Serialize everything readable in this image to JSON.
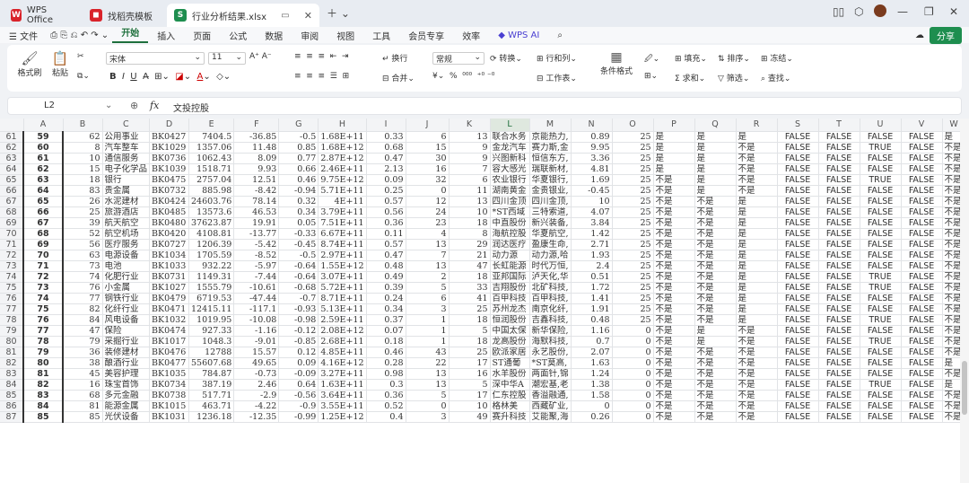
{
  "tabs": [
    {
      "label": "WPS Office"
    },
    {
      "label": "找稻壳模板"
    },
    {
      "label": "行业分析结果.xlsx"
    }
  ],
  "menubar": {
    "file": "文件",
    "items": [
      "开始",
      "插入",
      "页面",
      "公式",
      "数据",
      "审阅",
      "视图",
      "工具",
      "会员专享",
      "效率"
    ],
    "wps_ai": "WPS AI",
    "share": "分享"
  },
  "ribbon": {
    "format_painter": "格式刷",
    "paste": "粘贴",
    "font": "宋体",
    "font_size": "11",
    "wrap": "换行",
    "merge": "合并",
    "number_format": "常规",
    "convert": "转换",
    "rowcol": "行和列",
    "worksheet": "工作表",
    "cond_format": "条件格式",
    "fill": "填充",
    "sort": "排序",
    "freeze": "冻结",
    "sum": "求和",
    "filter": "筛选",
    "find": "查找"
  },
  "formula": {
    "cell_ref": "L2",
    "fx": "fx",
    "value": "文投控股"
  },
  "columns": [
    "A",
    "B",
    "C",
    "D",
    "E",
    "F",
    "G",
    "H",
    "I",
    "J",
    "K",
    "L",
    "M",
    "N",
    "O",
    "P",
    "Q",
    "R",
    "S",
    "T",
    "U",
    "V",
    "W"
  ],
  "rows": [
    [
      "61",
      "59",
      "62",
      "公用事业",
      "BK0427",
      "7404.5",
      "-36.85",
      "-0.5",
      "1.68E+11",
      "0.33",
      "6",
      "13",
      "联合水务",
      "京能热力,",
      "0.89",
      "25",
      "是",
      "是",
      "是",
      "FALSE",
      "FALSE",
      "FALSE",
      "FALSE",
      "是"
    ],
    [
      "62",
      "60",
      "8",
      "汽车整车",
      "BK1029",
      "1357.06",
      "11.48",
      "0.85",
      "1.68E+12",
      "0.68",
      "15",
      "9",
      "金龙汽车",
      "赛力斯,金",
      "9.95",
      "25",
      "是",
      "是",
      "不是",
      "FALSE",
      "FALSE",
      "TRUE",
      "FALSE",
      "不是"
    ],
    [
      "63",
      "61",
      "10",
      "通信服务",
      "BK0736",
      "1062.43",
      "8.09",
      "0.77",
      "2.87E+12",
      "0.47",
      "30",
      "9",
      "兴图新科",
      "恒信东方,",
      "3.36",
      "25",
      "是",
      "是",
      "不是",
      "FALSE",
      "FALSE",
      "FALSE",
      "FALSE",
      "不是"
    ],
    [
      "64",
      "62",
      "15",
      "电子化学品",
      "BK1039",
      "1518.71",
      "9.93",
      "0.66",
      "2.46E+11",
      "2.13",
      "16",
      "7",
      "容大感光",
      "瑞联新材,",
      "4.81",
      "25",
      "是",
      "是",
      "不是",
      "FALSE",
      "FALSE",
      "FALSE",
      "FALSE",
      "不是"
    ],
    [
      "65",
      "63",
      "18",
      "银行",
      "BK0475",
      "2757.04",
      "12.51",
      "0.46",
      "9.75E+12",
      "0.09",
      "32",
      "6",
      "农业银行",
      "华夏银行,",
      "1.69",
      "25",
      "不是",
      "是",
      "不是",
      "FALSE",
      "FALSE",
      "TRUE",
      "FALSE",
      "不是"
    ],
    [
      "66",
      "64",
      "83",
      "贵金属",
      "BK0732",
      "885.98",
      "-8.42",
      "-0.94",
      "5.71E+11",
      "0.25",
      "0",
      "11",
      "湖南黄金",
      "金贵银业,",
      "-0.45",
      "25",
      "不是",
      "是",
      "不是",
      "FALSE",
      "FALSE",
      "FALSE",
      "FALSE",
      "不是"
    ],
    [
      "67",
      "65",
      "26",
      "水泥建材",
      "BK0424",
      "24603.76",
      "78.14",
      "0.32",
      "4E+11",
      "0.57",
      "12",
      "13",
      "四川金顶",
      "四川金顶,",
      "10",
      "25",
      "不是",
      "不是",
      "是",
      "FALSE",
      "FALSE",
      "FALSE",
      "FALSE",
      "不是"
    ],
    [
      "68",
      "66",
      "25",
      "旅游酒店",
      "BK0485",
      "13573.6",
      "46.53",
      "0.34",
      "3.79E+11",
      "0.56",
      "24",
      "10",
      "*ST西域",
      "三特索道,",
      "4.07",
      "25",
      "不是",
      "不是",
      "是",
      "FALSE",
      "FALSE",
      "FALSE",
      "FALSE",
      "不是"
    ],
    [
      "69",
      "67",
      "39",
      "航天航空",
      "BK0480",
      "37623.87",
      "19.91",
      "0.05",
      "7.51E+11",
      "0.36",
      "23",
      "18",
      "中直股份",
      "新兴装备,",
      "3.84",
      "25",
      "不是",
      "不是",
      "是",
      "FALSE",
      "FALSE",
      "FALSE",
      "FALSE",
      "不是"
    ],
    [
      "70",
      "68",
      "52",
      "航空机场",
      "BK0420",
      "4108.81",
      "-13.77",
      "-0.33",
      "6.67E+11",
      "0.11",
      "4",
      "8",
      "海航控股",
      "华夏航空,",
      "1.42",
      "25",
      "不是",
      "不是",
      "是",
      "FALSE",
      "FALSE",
      "FALSE",
      "FALSE",
      "不是"
    ],
    [
      "71",
      "69",
      "56",
      "医疗服务",
      "BK0727",
      "1206.39",
      "-5.42",
      "-0.45",
      "8.74E+11",
      "0.57",
      "13",
      "29",
      "润达医疗",
      "盈康生命,",
      "2.71",
      "25",
      "不是",
      "不是",
      "是",
      "FALSE",
      "FALSE",
      "FALSE",
      "FALSE",
      "不是"
    ],
    [
      "72",
      "70",
      "63",
      "电源设备",
      "BK1034",
      "1705.59",
      "-8.52",
      "-0.5",
      "2.97E+11",
      "0.47",
      "7",
      "21",
      "动力源",
      "动力源,哈",
      "1.93",
      "25",
      "不是",
      "不是",
      "是",
      "FALSE",
      "FALSE",
      "FALSE",
      "FALSE",
      "不是"
    ],
    [
      "73",
      "71",
      "73",
      "电池",
      "BK1033",
      "932.22",
      "-5.97",
      "-0.64",
      "1.55E+12",
      "0.48",
      "13",
      "47",
      "长虹能源",
      "时代万恒,",
      "2.4",
      "25",
      "不是",
      "不是",
      "是",
      "FALSE",
      "FALSE",
      "FALSE",
      "FALSE",
      "不是"
    ],
    [
      "74",
      "72",
      "74",
      "化肥行业",
      "BK0731",
      "1149.31",
      "-7.44",
      "-0.64",
      "3.07E+11",
      "0.49",
      "2",
      "18",
      "亚邦国际",
      "泸天化,华",
      "0.51",
      "25",
      "不是",
      "不是",
      "是",
      "FALSE",
      "FALSE",
      "TRUE",
      "FALSE",
      "不是"
    ],
    [
      "75",
      "73",
      "76",
      "小金属",
      "BK1027",
      "1555.79",
      "-10.61",
      "-0.68",
      "5.72E+11",
      "0.39",
      "5",
      "33",
      "吉翔股份",
      "北矿科技,",
      "1.72",
      "25",
      "不是",
      "不是",
      "是",
      "FALSE",
      "FALSE",
      "TRUE",
      "FALSE",
      "不是"
    ],
    [
      "76",
      "74",
      "77",
      "钢铁行业",
      "BK0479",
      "6719.53",
      "-47.44",
      "-0.7",
      "8.71E+11",
      "0.24",
      "6",
      "41",
      "百甲科技",
      "百甲科技,",
      "1.41",
      "25",
      "不是",
      "不是",
      "是",
      "FALSE",
      "FALSE",
      "FALSE",
      "FALSE",
      "不是"
    ],
    [
      "77",
      "75",
      "82",
      "化纤行业",
      "BK0471",
      "12415.11",
      "-117.1",
      "-0.93",
      "5.13E+11",
      "0.34",
      "3",
      "25",
      "苏州龙杰",
      "南京化纤,",
      "1.91",
      "25",
      "不是",
      "不是",
      "是",
      "FALSE",
      "FALSE",
      "FALSE",
      "FALSE",
      "不是"
    ],
    [
      "78",
      "76",
      "84",
      "风电设备",
      "BK1032",
      "1019.95",
      "-10.08",
      "-0.98",
      "2.59E+11",
      "0.37",
      "1",
      "18",
      "恒润股份",
      "吉鑫科技,",
      "0.48",
      "25",
      "不是",
      "不是",
      "是",
      "FALSE",
      "FALSE",
      "TRUE",
      "FALSE",
      "不是"
    ],
    [
      "79",
      "77",
      "47",
      "保险",
      "BK0474",
      "927.33",
      "-1.16",
      "-0.12",
      "2.08E+12",
      "0.07",
      "1",
      "5",
      "中国太保",
      "新华保险,",
      "1.16",
      "0",
      "不是",
      "是",
      "不是",
      "FALSE",
      "FALSE",
      "FALSE",
      "FALSE",
      "不是"
    ],
    [
      "80",
      "78",
      "79",
      "采掘行业",
      "BK1017",
      "1048.3",
      "-9.01",
      "-0.85",
      "2.68E+11",
      "0.18",
      "1",
      "18",
      "龙高股份",
      "海默科技,",
      "0.7",
      "0",
      "不是",
      "是",
      "不是",
      "FALSE",
      "FALSE",
      "TRUE",
      "FALSE",
      "不是"
    ],
    [
      "81",
      "79",
      "36",
      "装修建材",
      "BK0476",
      "12788",
      "15.57",
      "0.12",
      "4.85E+11",
      "0.46",
      "43",
      "25",
      "欧派家居",
      "永艺股份,",
      "2.07",
      "0",
      "不是",
      "不是",
      "不是",
      "FALSE",
      "FALSE",
      "FALSE",
      "FALSE",
      "不是"
    ],
    [
      "82",
      "80",
      "38",
      "酿酒行业",
      "BK0477",
      "55607.68",
      "49.65",
      "0.09",
      "4.16E+12",
      "0.28",
      "22",
      "17",
      "ST通葡",
      "*ST莫高,",
      "1.63",
      "0",
      "不是",
      "不是",
      "不是",
      "FALSE",
      "FALSE",
      "FALSE",
      "FALSE",
      "是"
    ],
    [
      "83",
      "81",
      "45",
      "美容护理",
      "BK1035",
      "784.87",
      "-0.73",
      "-0.09",
      "3.27E+11",
      "0.98",
      "13",
      "16",
      "水羊股份",
      "两面针,锦",
      "1.24",
      "0",
      "不是",
      "不是",
      "不是",
      "FALSE",
      "FALSE",
      "FALSE",
      "FALSE",
      "不是"
    ],
    [
      "84",
      "82",
      "16",
      "珠宝首饰",
      "BK0734",
      "387.19",
      "2.46",
      "0.64",
      "1.63E+11",
      "0.3",
      "13",
      "5",
      "深中华A",
      "潮宏基,老",
      "1.38",
      "0",
      "不是",
      "不是",
      "不是",
      "FALSE",
      "FALSE",
      "TRUE",
      "FALSE",
      "是"
    ],
    [
      "85",
      "83",
      "68",
      "多元金融",
      "BK0738",
      "517.71",
      "-2.9",
      "-0.56",
      "3.64E+11",
      "0.36",
      "5",
      "17",
      "仁东控股",
      "香溢融通,",
      "1.58",
      "0",
      "不是",
      "不是",
      "不是",
      "FALSE",
      "FALSE",
      "FALSE",
      "FALSE",
      "不是"
    ],
    [
      "86",
      "84",
      "81",
      "能源金属",
      "BK1015",
      "463.71",
      "-4.22",
      "-0.9",
      "3.55E+11",
      "0.52",
      "0",
      "10",
      "格林美",
      "西藏矿业,",
      "0",
      "0",
      "不是",
      "不是",
      "不是",
      "FALSE",
      "FALSE",
      "FALSE",
      "FALSE",
      "不是"
    ],
    [
      "87",
      "85",
      "85",
      "光伏设备",
      "BK1031",
      "1236.18",
      "-12.35",
      "-0.99",
      "1.25E+12",
      "0.4",
      "3",
      "49",
      "赛升科技",
      "艾能聚,海",
      "0.26",
      "0",
      "不是",
      "不是",
      "不是",
      "FALSE",
      "FALSE",
      "FALSE",
      "FALSE",
      "不是"
    ]
  ]
}
